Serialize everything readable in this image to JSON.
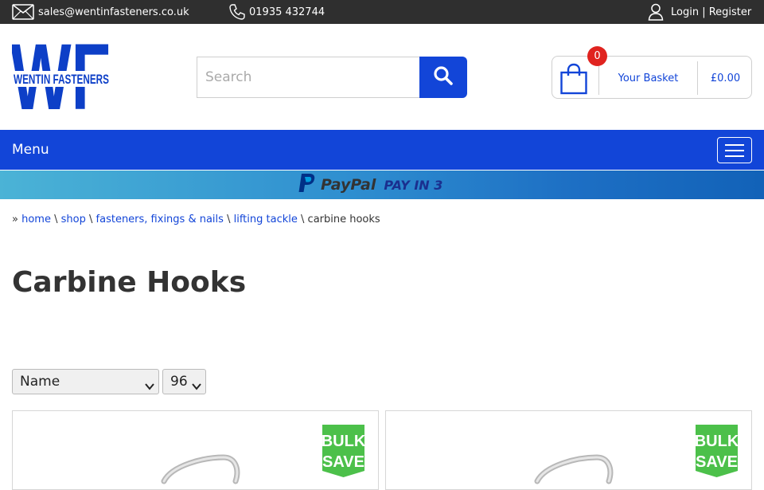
{
  "topbar": {
    "email": "sales@wentinfasteners.co.uk",
    "phone": "01935 432744",
    "account": "Login | Register",
    "icons": [
      "envelope-icon",
      "phone-icon",
      "user-icon"
    ]
  },
  "header": {
    "logo_text": "WENTIN FASTENERS",
    "logo_letters": "WF",
    "search_placeholder": "Search",
    "basket": {
      "count": "0",
      "label": "Your Basket",
      "total": "£0.00"
    }
  },
  "nav": {
    "menu_label": "Menu"
  },
  "banner": {
    "brand": "PayPal",
    "tagline": "PAY IN 3"
  },
  "breadcrumb": {
    "prefix": "»",
    "separator": "\\",
    "links": [
      "home",
      "shop",
      "fasteners, fixings & nails",
      "lifting tackle"
    ],
    "current": "carbine hooks"
  },
  "page": {
    "title": "Carbine Hooks"
  },
  "controls": {
    "sort_value": "Name",
    "per_page_value": "96"
  },
  "products": [
    {
      "badge_line1": "BULK",
      "badge_line2": "SAVE"
    },
    {
      "badge_line1": "BULK",
      "badge_line2": "SAVE"
    }
  ],
  "colors": {
    "brand_blue": "#1245d8",
    "topbar_bg": "#2f2f2f",
    "badge_red": "#e0231f",
    "bulk_green": "#4cc04a"
  }
}
